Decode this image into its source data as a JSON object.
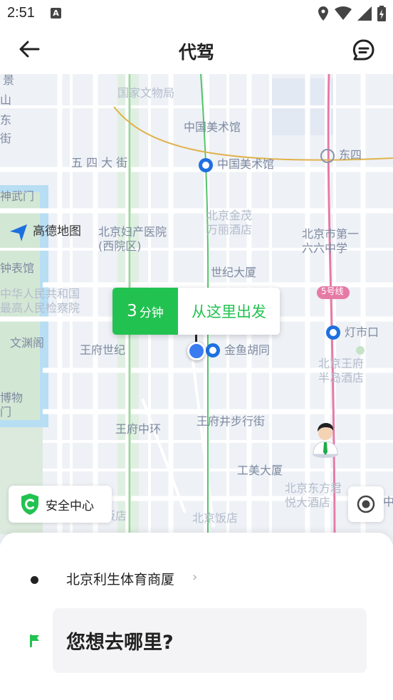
{
  "status_bar": {
    "time": "2:51",
    "notification_icon": "A"
  },
  "header": {
    "title": "代驾",
    "back_icon": "arrow-left-icon",
    "message_icon": "message-icon"
  },
  "map": {
    "logo_text": "高德地图",
    "labels": {
      "museum": "国家文物局",
      "art_gallery": "中国美术馆",
      "wusi_street": "五 四 大 街",
      "art_gallery_metro": "中国美术馆",
      "dongsi": "东四",
      "shenwu_gate": "神武门",
      "beijing_jinmao": "北京金茂",
      "wanli_hotel": "万丽酒店",
      "hospital_1": "北京妇产医院",
      "hospital_2": "(西院区)",
      "no166_1": "北京市第一",
      "no166_2": "六六中学",
      "shengbiao": "钟表馆",
      "century_tower": "世纪大厦",
      "line5": "5号线",
      "procuratorate_1": "中华人民共和国",
      "procuratorate_2": "最高人民检察院",
      "dengshikou": "灯市口",
      "wenyuan": "文渊阁",
      "wangfu_century": "王府世纪",
      "jinyu_hutong": "金鱼胡同",
      "peninsula_1": "北京王府",
      "peninsula_2": "半岛酒店",
      "museum_2a": "博物",
      "museum_2b": "门",
      "wangfu_zhonghuan": "王府中环",
      "pedestrian_street": "王府井步行街",
      "gongmei": "工美大厦",
      "oriental_1": "北京东方君",
      "oriental_2": "悦大酒店",
      "beijing_hotel": "北京饭店",
      "fandian_left": "饭店",
      "left_edge_1": "景",
      "left_edge_2": "山",
      "left_edge_3": "东",
      "left_edge_4": "街",
      "right_edge": "中"
    },
    "pickup_bubble": {
      "minutes": "3",
      "unit": "分钟",
      "action": "从这里出发"
    },
    "safety_center": "安全中心"
  },
  "trip": {
    "from": "北京利生体育商厦",
    "destination_placeholder": "您想去哪里?"
  },
  "colors": {
    "brand_green": "#22c251",
    "location_blue": "#3b7bf0",
    "map_bg": "#eef1f6"
  }
}
